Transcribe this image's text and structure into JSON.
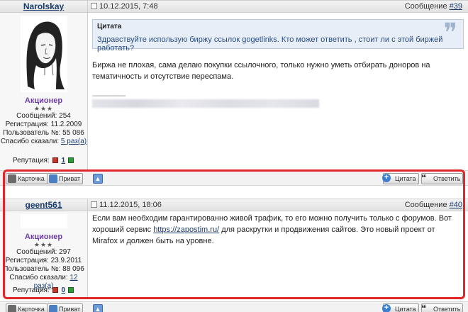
{
  "posts": [
    {
      "author": "Narolskay",
      "date": "10.12.2015, 7:48",
      "post_label": "Сообщение",
      "post_number": "#39",
      "rank": "Акционер",
      "stars": "★★★",
      "stats": {
        "messages": "Сообщений: 254",
        "registration": "Регистрация: 11.2.2009",
        "user_no": "Пользователь №: 55 086",
        "thanks_label": "Спасибо сказали:",
        "thanks_value": "5 раз(а)"
      },
      "reputation_label": "Репутация:",
      "reputation_value": "1",
      "quote": {
        "title": "Цитата",
        "text": "Здравствуйте использую биржу ссылок gogetlinks. Кто может ответить , стоит ли с этой биржей работать?"
      },
      "message": "Биржа не плохая, сама делаю покупки ссылочного, только нужно уметь отбирать доноров на тематичность и отсутствие переспама.",
      "signature_divider": "--------------------"
    },
    {
      "author": "geent561",
      "date": "11.12.2015, 18:06",
      "post_label": "Сообщение",
      "post_number": "#40",
      "rank": "Акционер",
      "stars": "★★★",
      "stats": {
        "messages": "Сообщений: 297",
        "registration": "Регистрация: 23.9.2011",
        "user_no": "Пользователь №: 88 096",
        "thanks_label": "Спасибо сказали:",
        "thanks_value": "12 раз(а)"
      },
      "reputation_label": "Репутация:",
      "reputation_value": "0",
      "message_part1": "Если вам необходим гарантированно живой трафик, то его можно получить только с форумов. Вот хороший сервис",
      "message_link": "https://zapostim.ru/",
      "message_part2": "для раскрутки и продвижения сайтов. Это новый проект от Mirafox и должен быть на уровне."
    }
  ],
  "toolbar": {
    "card_label": "Карточка",
    "private_label": "Приват",
    "quote_label": "Цитата",
    "reply_label": "Ответить"
  },
  "icons": {
    "date": "post-date-icon",
    "card": "card-icon",
    "mail": "mail-icon",
    "arrow": "arrow-up-icon",
    "quote_add": "plus-icon",
    "reply": "reply-icon"
  },
  "colors": {
    "highlight": "#e0262b",
    "link": "#1a3d6b",
    "rank": "#6b3fa0",
    "quote_bg": "#e7eef8"
  }
}
